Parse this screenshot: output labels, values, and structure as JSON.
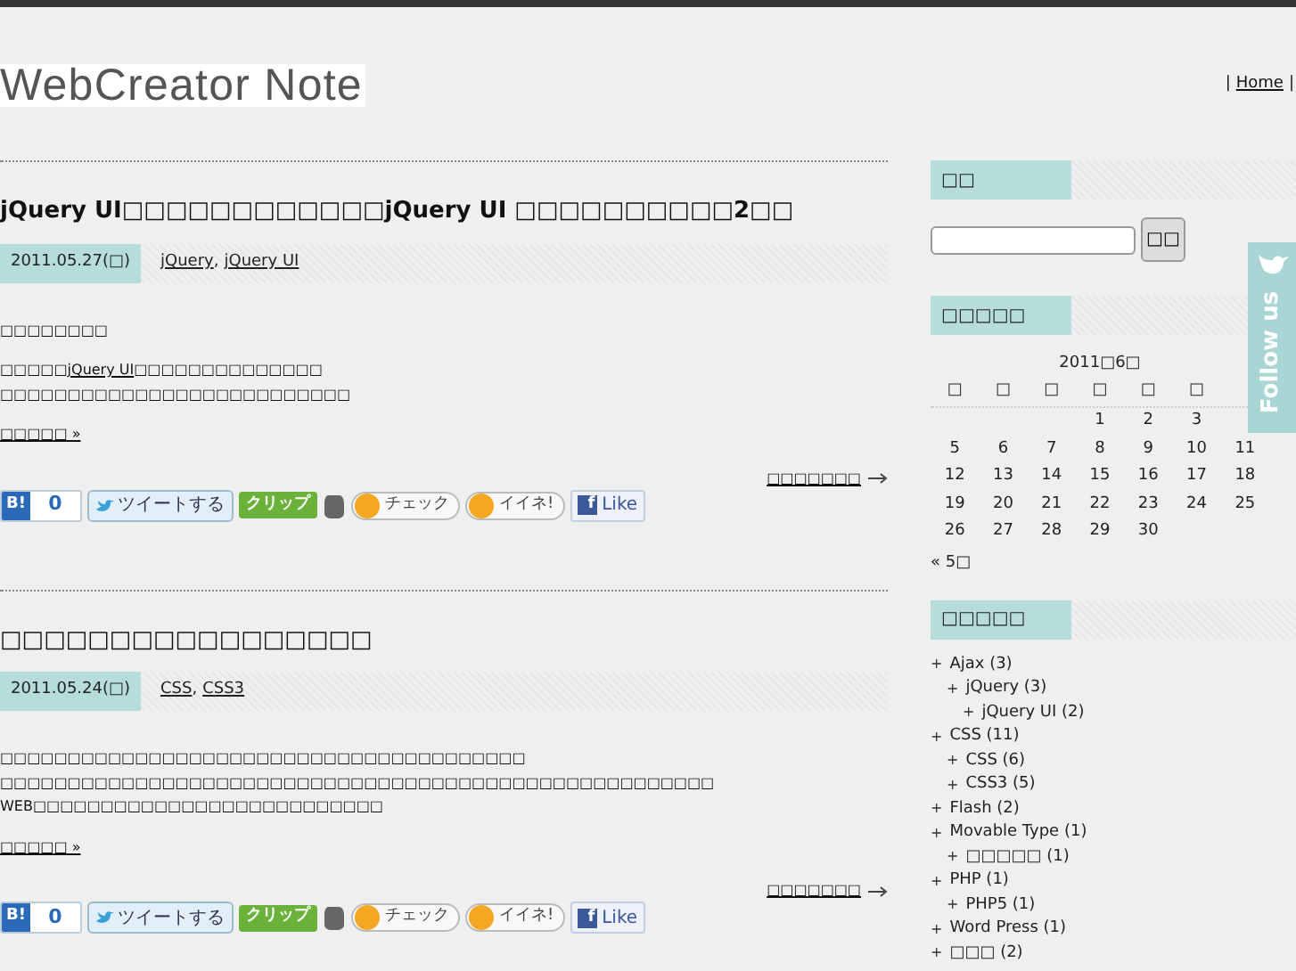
{
  "site": {
    "logo": "WebCreator Note",
    "nav": [
      {
        "label": "Home"
      }
    ],
    "nav_separator": "|"
  },
  "posts": [
    {
      "title": "jQuery UI□□□□□□□□□□□□jQuery UI □□□□□□□□□□2□□",
      "date": "2011.05.27(□)",
      "categories": [
        {
          "label": "jQuery"
        },
        {
          "label": "jQuery UI"
        }
      ],
      "category_separator": ",",
      "paragraphs": [
        [
          [
            {
              "kind": "text",
              "text": "□□□□□□□□"
            }
          ]
        ],
        [
          [
            {
              "kind": "text",
              "text": "□□□□□"
            },
            {
              "kind": "link",
              "text": "jQuery UI"
            },
            {
              "kind": "text",
              "text": "□□□□□□□□□□□□□□"
            }
          ],
          [
            {
              "kind": "text",
              "text": "□□□□□□□□□□□□□□□□□□□□□□□□□□"
            }
          ]
        ]
      ],
      "more": "□□□□□ »",
      "continue": "□□□□□□□",
      "share": {
        "hatena": "B!",
        "hatena_count": "0",
        "tweet": "ツイートする",
        "clip": "クリップ",
        "check": "チェック",
        "iine": "イイネ!",
        "like_logo": "f",
        "like": "Like"
      }
    },
    {
      "title": "□□□□□□□□□□□□□□□□□",
      "date": "2011.05.24(□)",
      "categories": [
        {
          "label": "CSS"
        },
        {
          "label": "CSS3"
        }
      ],
      "category_separator": ",",
      "paragraphs": [
        [
          [
            {
              "kind": "text",
              "text": "□□□□□□□□□□□□□□□□□□□□□□□□□□□□□□□□□□□□□□□"
            }
          ],
          [
            {
              "kind": "text",
              "text": "□□□□□□□□□□□□□□□□□□□□□□□□□□□□□□□□□□□□□□□□□□□□□□□□□□□□□"
            }
          ],
          [
            {
              "kind": "text",
              "text": "WEB□□□□□□□□□□□□□□□□□□□□□□□□□□"
            }
          ]
        ]
      ],
      "more": "□□□□□ »",
      "continue": "□□□□□□□",
      "share": {
        "hatena": "B!",
        "hatena_count": "0",
        "tweet": "ツイートする",
        "clip": "クリップ",
        "check": "チェック",
        "iine": "イイネ!",
        "like_logo": "f",
        "like": "Like"
      }
    }
  ],
  "sidebar": {
    "search": {
      "heading": "□□",
      "button": "□□"
    },
    "calendar": {
      "heading": "□□□□□",
      "caption": "2011□6□",
      "weekdays": [
        "□",
        "□",
        "□",
        "□",
        "□",
        "□"
      ],
      "weeks": [
        {
          "kind": "first",
          "days": [
            "1",
            "2",
            "3"
          ]
        },
        {
          "kind": "full",
          "days": [
            "5",
            "6",
            "7",
            "8",
            "9",
            "10",
            "11"
          ]
        },
        {
          "kind": "full",
          "days": [
            "12",
            "13",
            "14",
            "15",
            "16",
            "17",
            "18"
          ]
        },
        {
          "kind": "full",
          "days": [
            "19",
            "20",
            "21",
            "22",
            "23",
            "24",
            "25"
          ]
        },
        {
          "kind": "full",
          "days": [
            "26",
            "27",
            "28",
            "29",
            "30"
          ]
        }
      ],
      "prev": "« 5□"
    },
    "categories": {
      "heading": "□□□□□",
      "bullet": "+",
      "items": [
        {
          "label": "Ajax (3)",
          "children": [
            {
              "label": "jQuery (3)",
              "children": [
                {
                  "label": "jQuery UI (2)"
                }
              ]
            }
          ]
        },
        {
          "label": "CSS (11)",
          "children": [
            {
              "label": "CSS (6)"
            },
            {
              "label": "CSS3 (5)"
            }
          ]
        },
        {
          "label": "Flash (2)"
        },
        {
          "label": "Movable Type (1)",
          "children": [
            {
              "label": "□□□□□ (1)"
            }
          ]
        },
        {
          "label": "PHP (1)",
          "children": [
            {
              "label": "PHP5 (1)"
            }
          ]
        },
        {
          "label": "Word Press (1)"
        },
        {
          "label": "□□□ (2)"
        }
      ]
    },
    "follow_tab": "Follow us"
  }
}
